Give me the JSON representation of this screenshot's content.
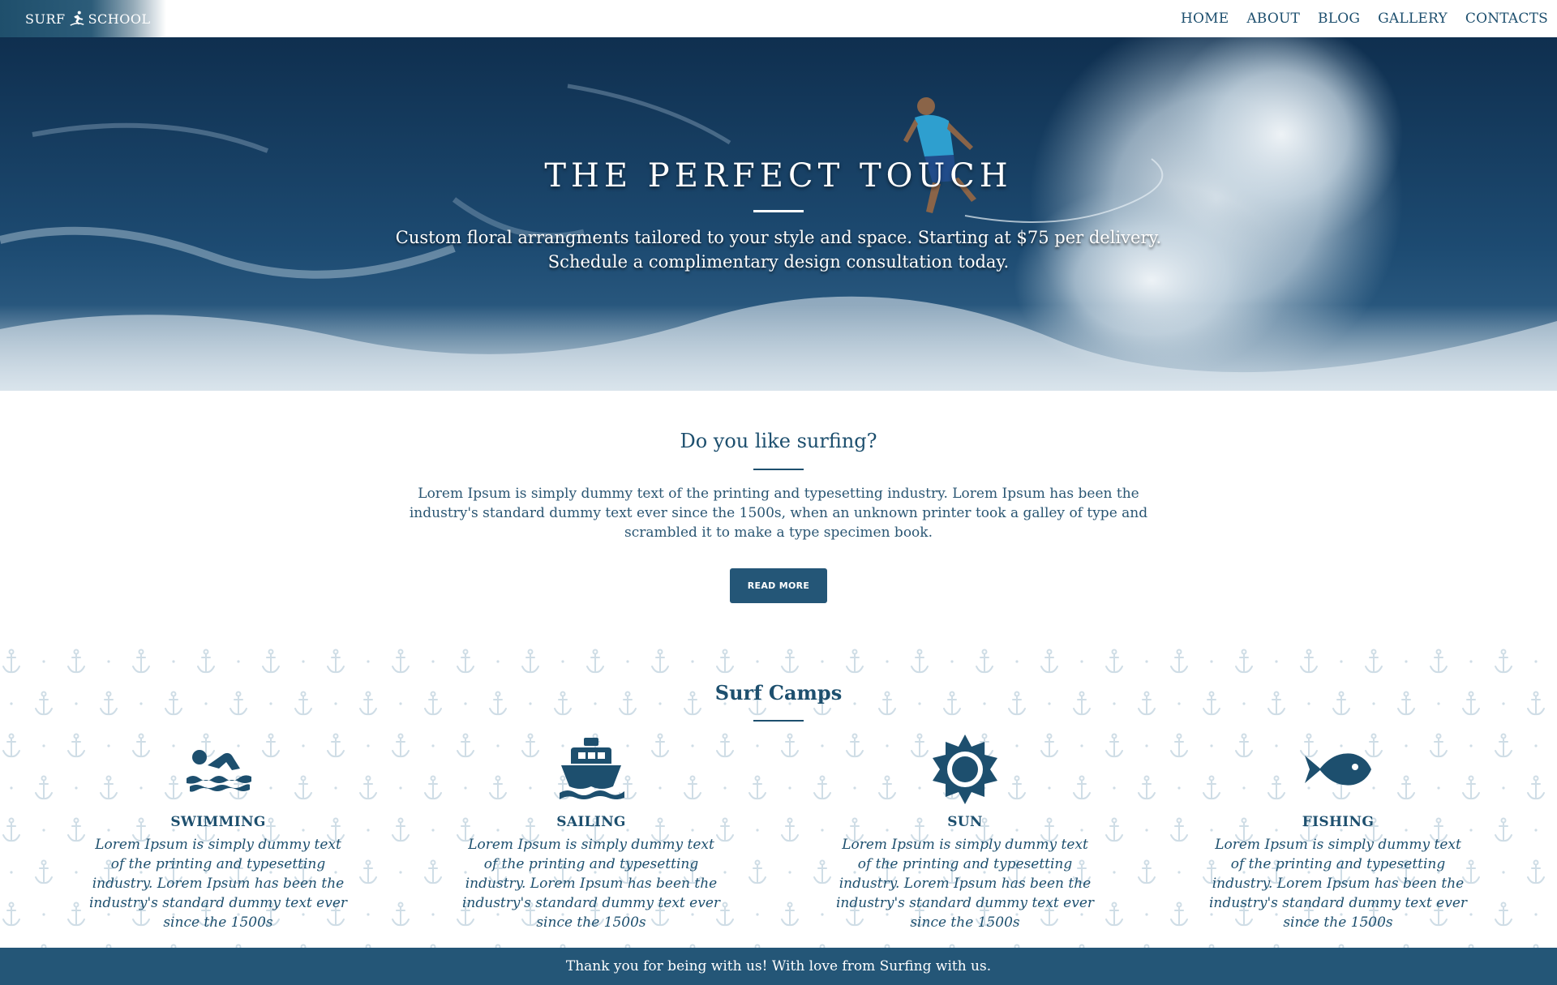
{
  "nav": {
    "logo_left": "SURF",
    "logo_right": "SCHOOL",
    "items": [
      {
        "label": "HOME"
      },
      {
        "label": "ABOUT"
      },
      {
        "label": "BLOG"
      },
      {
        "label": "GALLERY"
      },
      {
        "label": "CONTACTS"
      }
    ]
  },
  "hero": {
    "title": "THE PERFECT TOUCH",
    "line1": "Custom floral arrangments tailored to your style and space. Starting at $75 per delivery.",
    "line2": "Schedule a complimentary design consultation today."
  },
  "intro": {
    "heading": "Do you like surfing?",
    "body": "Lorem Ipsum is simply dummy text of the printing and typesetting industry. Lorem Ipsum has been the industry's standard dummy text ever since the 1500s, when an unknown printer took a galley of type and scrambled it to make a type specimen book.",
    "button": "READ MORE"
  },
  "camps": {
    "heading": "Surf Camps",
    "items": [
      {
        "icon": "swimmer-icon",
        "title": "SWIMMING",
        "text": "Lorem Ipsum is simply dummy text of the printing and typesetting industry. Lorem Ipsum has been the industry's standard dummy text ever since the 1500s"
      },
      {
        "icon": "ship-icon",
        "title": "SAILING",
        "text": "Lorem Ipsum is simply dummy text of the printing and typesetting industry. Lorem Ipsum has been the industry's standard dummy text ever since the 1500s"
      },
      {
        "icon": "sun-icon",
        "title": "SUN",
        "text": "Lorem Ipsum is simply dummy text of the printing and typesetting industry. Lorem Ipsum has been the industry's standard dummy text ever since the 1500s"
      },
      {
        "icon": "fish-icon",
        "title": "FISHING",
        "text": "Lorem Ipsum is simply dummy text of the printing and typesetting industry. Lorem Ipsum has been the industry's standard dummy text ever since the 1500s"
      }
    ]
  },
  "footer": {
    "text": "Thank you for being with us! With love from Surfing with us."
  },
  "colors": {
    "primary": "#245677",
    "text": "#1d4f6e",
    "pattern": "#cfdde6"
  }
}
